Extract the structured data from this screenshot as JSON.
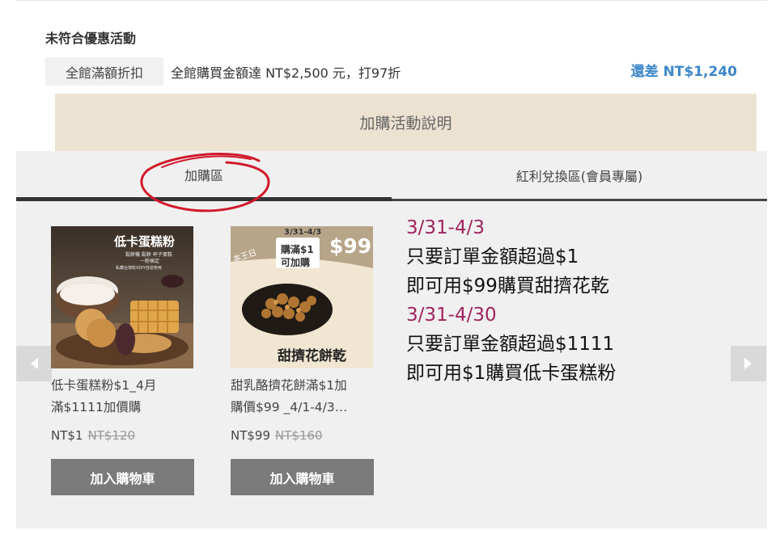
{
  "promo": {
    "section_title": "未符合優惠活動",
    "tag": "全館滿額折扣",
    "description": "全館購買金額達 NT$2,500 元，打97折",
    "remaining": "還差 NT$1,240"
  },
  "addon_bar": {
    "label": "加購活動說明"
  },
  "tabs": [
    {
      "label": "加購區",
      "active": true
    },
    {
      "label": "紅利兌換區(會員專屬)",
      "active": false
    }
  ],
  "products": [
    {
      "image_text": {
        "title": "低卡蛋糕粉",
        "sub1": "鬆餅機 鬆餅 杯子蛋糕",
        "sub2": "一粉搞定",
        "sub3": "私藏台灣粉XDIY自從使用"
      },
      "name": "低卡蛋糕粉$1_4月滿$1111加價購",
      "name_line1": "低卡蛋糕粉$1_4月",
      "name_line2": "滿$1111加價購",
      "price": "NT$1",
      "original_price": "NT$120",
      "button": "加入購物車"
    },
    {
      "image_text": {
        "date": "3/31-4/3",
        "promo": "購滿$1",
        "promo2": "可加購",
        "price": "$99",
        "title": "甜擠花餅乾",
        "brand": "本王日"
      },
      "name": "甜乳酪擠花餅滿$1加購價$99 _4/1-4/3…",
      "name_line1": "甜乳酪擠花餅滿$1加",
      "name_line2": "購價$99 _4/1-4/3…",
      "price": "NT$99",
      "original_price": "NT$160",
      "button": "加入購物車"
    }
  ],
  "info": {
    "date1": "3/31-4/3",
    "line1": "只要訂單金額超過$1",
    "line2": "即可用$99購買甜擠花乾",
    "date2": "3/31-4/30",
    "line3": "只要訂單金額超過$1111",
    "line4": "即可用$1購買低卡蛋糕粉"
  },
  "colors": {
    "accent_blue": "#3c87c9",
    "date_magenta": "#a0245e",
    "annotation_red": "#d1192b",
    "button_gray": "#7a7a7a",
    "addon_bar_bg": "#ece2d2"
  },
  "icons": {
    "prev": "chevron-left-icon",
    "next": "chevron-right-icon"
  }
}
